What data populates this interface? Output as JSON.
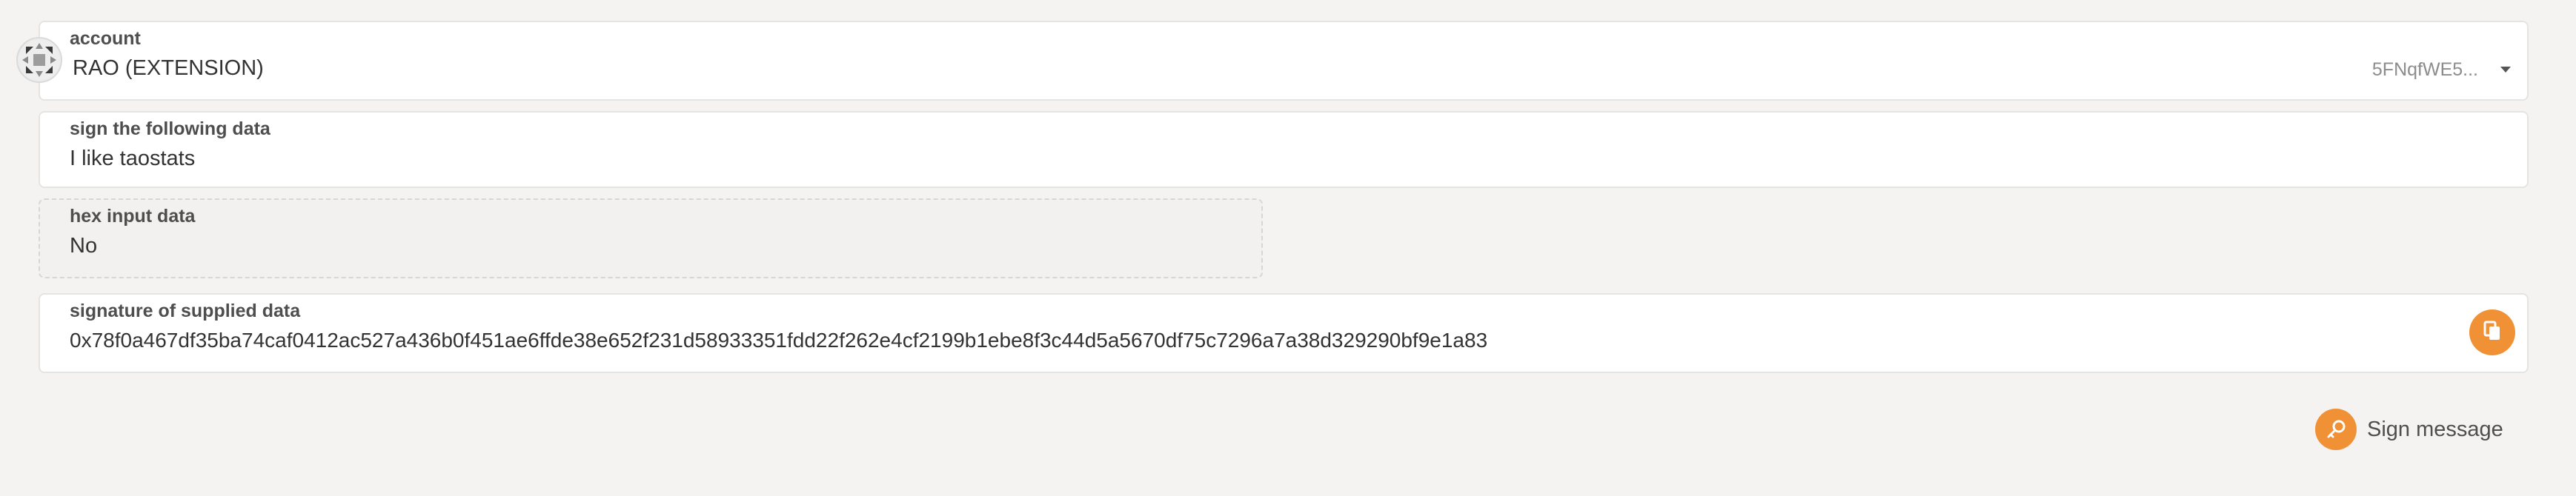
{
  "account": {
    "label": "account",
    "name": "RAO (EXTENSION)",
    "address_short": "5FNqfWE5...",
    "avatar_icon": "identicon-avatar",
    "dropdown_icon": "caret-down-icon"
  },
  "sign_data": {
    "label": "sign the following data",
    "value": "I like taostats"
  },
  "hex_input": {
    "label": "hex input data",
    "value": "No"
  },
  "signature": {
    "label": "signature of supplied data",
    "value": "0x78f0a467df35ba74caf0412ac527a436b0f451ae6ffde38e652f231d58933351fdd22f262e4cf2199b1ebe8f3c44d5a5670df75c7296a7a38d329290bf9e1a83",
    "copy_icon": "copy-icon"
  },
  "actions": {
    "sign_label": "Sign message",
    "sign_icon": "key-icon"
  },
  "colors": {
    "accent": "#f19135",
    "background": "#f4f3f2"
  }
}
